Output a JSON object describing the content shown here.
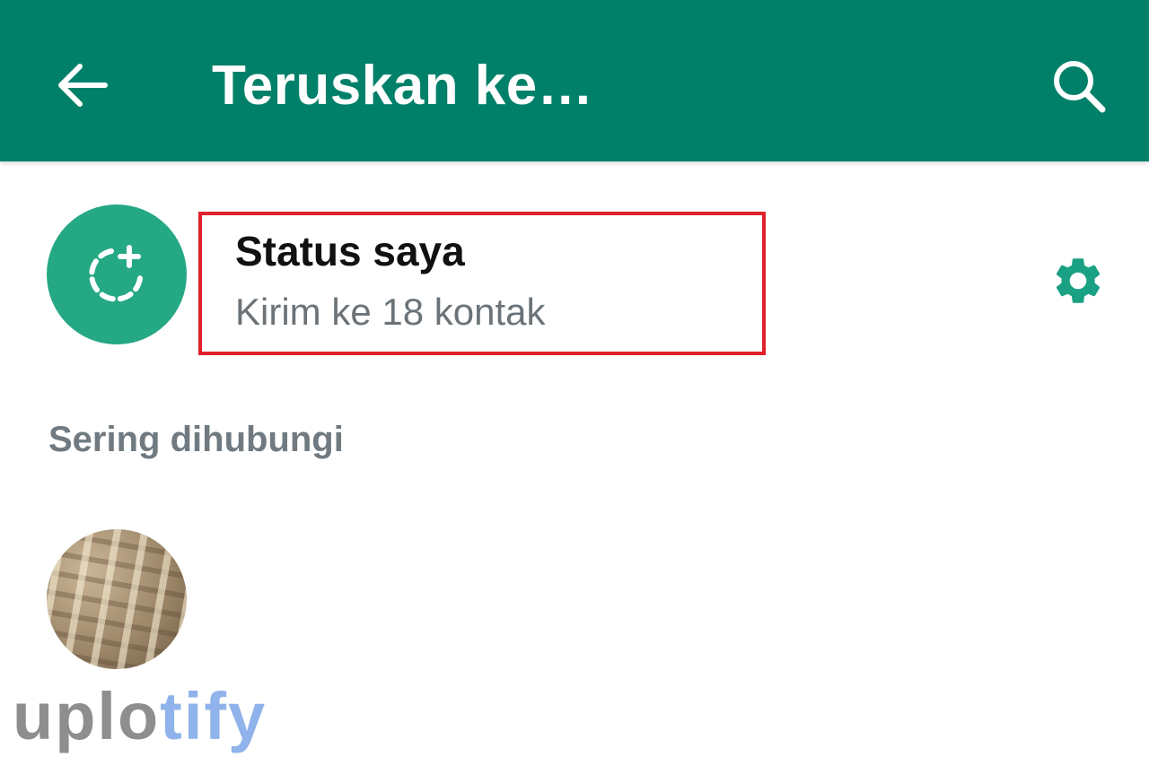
{
  "appbar": {
    "title": "Teruskan ke…",
    "back_icon": "arrow-left-icon",
    "search_icon": "search-icon",
    "color": "#008069"
  },
  "status": {
    "name": "Status saya",
    "subtitle": "Kirim ke 18 kontak",
    "avatar_icon": "status-add-icon",
    "settings_icon": "gear-icon",
    "avatar_color": "#25a884",
    "highlight_color": "#e0202a"
  },
  "section": {
    "label": "Sering dihubungi"
  },
  "watermark": {
    "part1": "uplo",
    "part2": "tify"
  }
}
